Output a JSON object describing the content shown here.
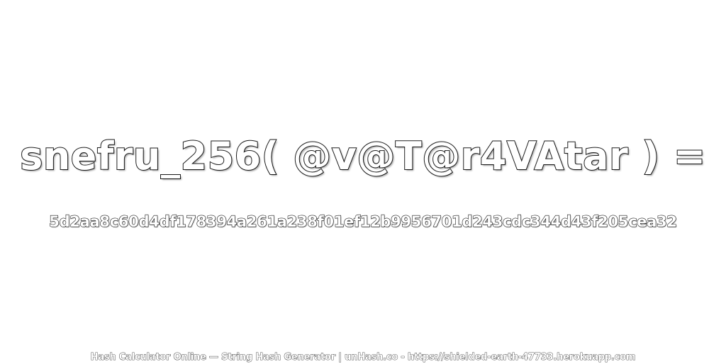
{
  "expression": "snefru_256( @v@T@r4VAtar ) =",
  "hash_value": "5d2aa8c60d4df178394a261a238f01ef12b9956701d243cdc344d43f205cea32",
  "footer": "Hash Calculator Online — String Hash Generator | unHash.co - https://shielded-earth-47733.herokuapp.com",
  "colors": {
    "background": "#ffffff",
    "text_fill": "#ffffff",
    "text_outline": "#1a1a1a"
  }
}
